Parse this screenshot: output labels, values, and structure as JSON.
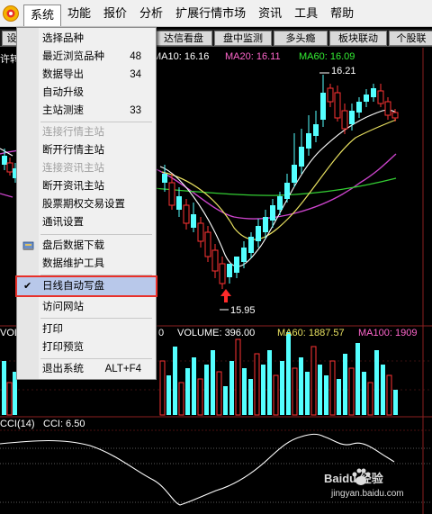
{
  "menubar": {
    "items": [
      "系统",
      "功能",
      "报价",
      "分析",
      "扩展行情市场",
      "资讯",
      "工具",
      "帮助"
    ]
  },
  "tabs": [
    "设",
    "达信看盘",
    "盘中监测",
    "多头瘾",
    "板块联动",
    "个股联"
  ],
  "dropdown": {
    "items": [
      {
        "label": "选择品种",
        "value": "",
        "disabled": false
      },
      {
        "label": "最近浏览品种",
        "value": "48",
        "disabled": false
      },
      {
        "label": "数据导出",
        "value": "34",
        "disabled": false
      },
      {
        "label": "自动升级",
        "value": "",
        "disabled": false
      },
      {
        "label": "主站测速",
        "value": "33",
        "disabled": false
      },
      {
        "label": "连接行情主站",
        "value": "",
        "disabled": true
      },
      {
        "label": "断开行情主站",
        "value": "",
        "disabled": false
      },
      {
        "label": "连接资讯主站",
        "value": "",
        "disabled": true
      },
      {
        "label": "断开资讯主站",
        "value": "",
        "disabled": false
      },
      {
        "label": "股票期权交易设置",
        "value": "",
        "disabled": false
      },
      {
        "label": "通讯设置",
        "value": "",
        "disabled": false
      },
      {
        "label": "盘后数据下载",
        "value": "",
        "disabled": false
      },
      {
        "label": "数据维护工具",
        "value": "",
        "disabled": false
      },
      {
        "label": "日线自动写盘",
        "value": "",
        "disabled": false
      },
      {
        "label": "访问网站",
        "value": "",
        "disabled": false
      },
      {
        "label": "打印",
        "value": "",
        "disabled": false
      },
      {
        "label": "打印预览",
        "value": "",
        "disabled": false
      },
      {
        "label": "退出系统",
        "value": "ALT+F4",
        "disabled": false
      }
    ]
  },
  "chart": {
    "title_fragment": "许转",
    "ma10": "MA10: 16.16",
    "ma20": "MA20: 16.11",
    "ma60": "MA60: 16.09",
    "high_label": "16.21",
    "low_label": "15.95",
    "vol_prefix": "VOL",
    "vol_zero": "0",
    "volume": "VOLUME: 396.00",
    "vol_ma60": "MA60: 1887.57",
    "vol_ma100": "MA100: 1909",
    "cci_label": "CCI(14)",
    "cci_value": "CCI: 6.50"
  },
  "watermark": {
    "brand": "Baidu 经验",
    "url": "jingyan.baidu.com"
  },
  "colors": {
    "rise": "#ff3333",
    "fall": "#54ffff",
    "ma_white": "#ffffff",
    "ma_yellow": "#e8e060",
    "ma_green": "#33cc33",
    "ma_magenta": "#cc44cc",
    "highlight_border": "#e8302a"
  }
}
